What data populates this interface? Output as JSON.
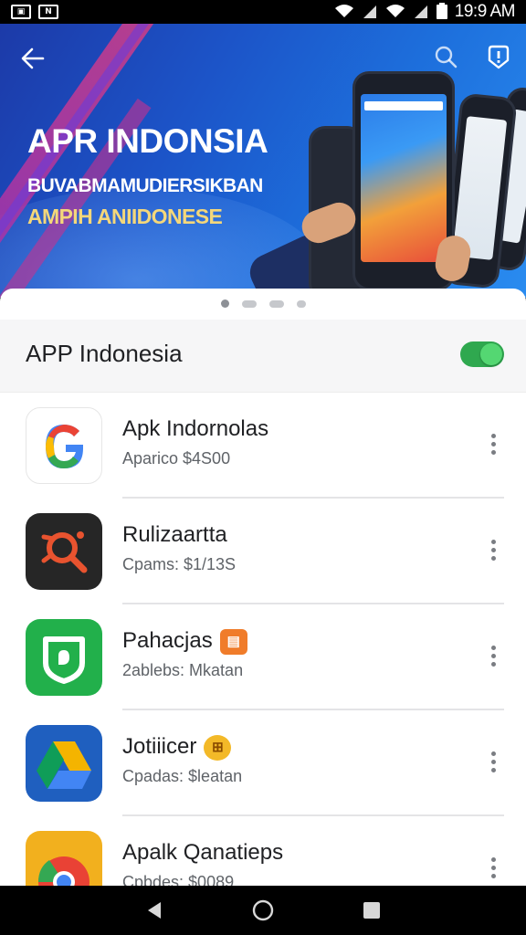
{
  "status_bar": {
    "time": "19:9 AM",
    "left_icons": [
      "image-icon",
      "nfc-icon"
    ],
    "right_icons": [
      "wifi-icon",
      "signal-icon",
      "wifi-icon",
      "signal-icon",
      "battery-icon"
    ]
  },
  "banner": {
    "title": "APR INDONSIA",
    "subtitle_1": "BUVABMAMUDIERSIKBAN",
    "subtitle_2": "AMPIH ANIIDONESE",
    "page_dots": 4,
    "active_dot": 0
  },
  "section": {
    "title": "APP Indonesia",
    "toggle_on": true
  },
  "apps": [
    {
      "name": "Apk Indornolas",
      "subtitle": "Aparico $4S00",
      "icon": "google-icon"
    },
    {
      "name": "Rulizaartta",
      "subtitle": "Cpams: $1/13S",
      "icon": "search-tool-icon"
    },
    {
      "name": "Pahacjas",
      "subtitle": "2ablebs: Mkatan",
      "icon": "shield-app-icon",
      "badge": "orange"
    },
    {
      "name": "Jotiiicer",
      "subtitle": "Cpadas: $leatan",
      "icon": "drive-icon",
      "badge": "yellow"
    },
    {
      "name": "Apalk Qanatieps",
      "subtitle": "Cpbdes: $0089",
      "icon": "chrome-like-icon"
    }
  ],
  "colors": {
    "accent_green": "#2fa84f",
    "banner_blue": "#1d6fdc",
    "banner_yellow": "#f4d77a"
  },
  "nav": [
    "back-icon",
    "home-icon",
    "recents-icon"
  ]
}
